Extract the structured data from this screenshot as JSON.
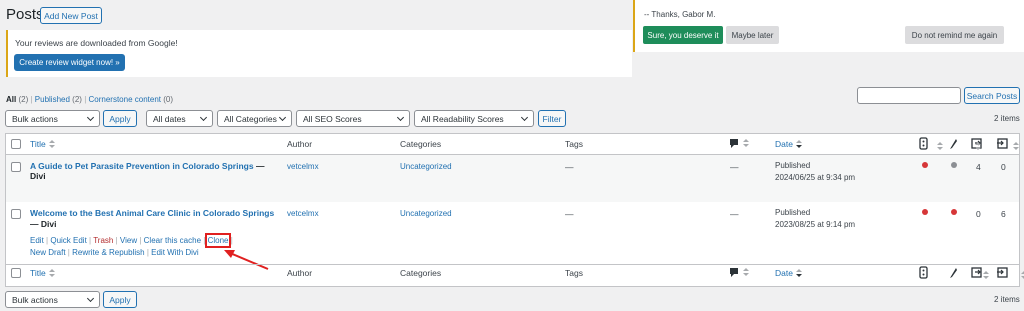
{
  "page": {
    "title": "Posts",
    "add_new": "Add New Post"
  },
  "notices": {
    "reviews_text": "Your reviews are downloaded from Google!",
    "reviews_button": "Create review widget now! »",
    "thanks": "-- Thanks, Gabor M.",
    "sure": "Sure, you deserve it",
    "later": "Maybe later",
    "no_remind": "Do not remind me again"
  },
  "views": {
    "all": "All",
    "all_count": "(2)",
    "published": "Published",
    "published_count": "(2)",
    "cornerstone": "Cornerstone content",
    "cornerstone_count": "(0)"
  },
  "search": {
    "button": "Search Posts",
    "value": ""
  },
  "filters": {
    "bulk": "Bulk actions",
    "apply": "Apply",
    "dates": "All dates",
    "categories": "All Categories",
    "seo": "All SEO Scores",
    "readability": "All Readability Scores",
    "filter": "Filter"
  },
  "count": "2 items",
  "table": {
    "headers": {
      "title": "Title",
      "author": "Author",
      "categories": "Categories",
      "tags": "Tags",
      "date": "Date"
    },
    "rows": [
      {
        "title": "A Guide to Pet Parasite Prevention in Colorado Springs",
        "suffix": "— Divi",
        "author": "vetcelmx",
        "category": "Uncategorized",
        "tags": "—",
        "comments": "—",
        "status": "Published",
        "date": "2024/06/25 at 9:34 pm",
        "seo": "#d63638",
        "read": "#8c8f94",
        "links_in": "4",
        "links_out": "0"
      },
      {
        "title": "Welcome to the Best Animal Care Clinic in Colorado Springs",
        "suffix": "— Divi",
        "author": "vetcelmx",
        "category": "Uncategorized",
        "tags": "—",
        "comments": "—",
        "status": "Published",
        "date": "2023/08/25 at 9:14 pm",
        "seo": "#d63638",
        "read": "#d63638",
        "links_in": "0",
        "links_out": "6",
        "actions": {
          "edit": "Edit",
          "quick_edit": "Quick Edit",
          "trash": "Trash",
          "view": "View",
          "clear_cache": "Clear this cache",
          "clone": "Clone",
          "new_draft": "New Draft",
          "rewrite": "Rewrite & Republish",
          "edit_divi": "Edit With Divi"
        }
      }
    ]
  },
  "colors": {
    "accent": "#2271b1",
    "highlight": "#e02020",
    "primary_green": "#1e8d5a"
  },
  "icons": [
    "comment-icon",
    "seo-score-icon",
    "readability-icon",
    "internal-links-icon",
    "incoming-links-icon"
  ]
}
